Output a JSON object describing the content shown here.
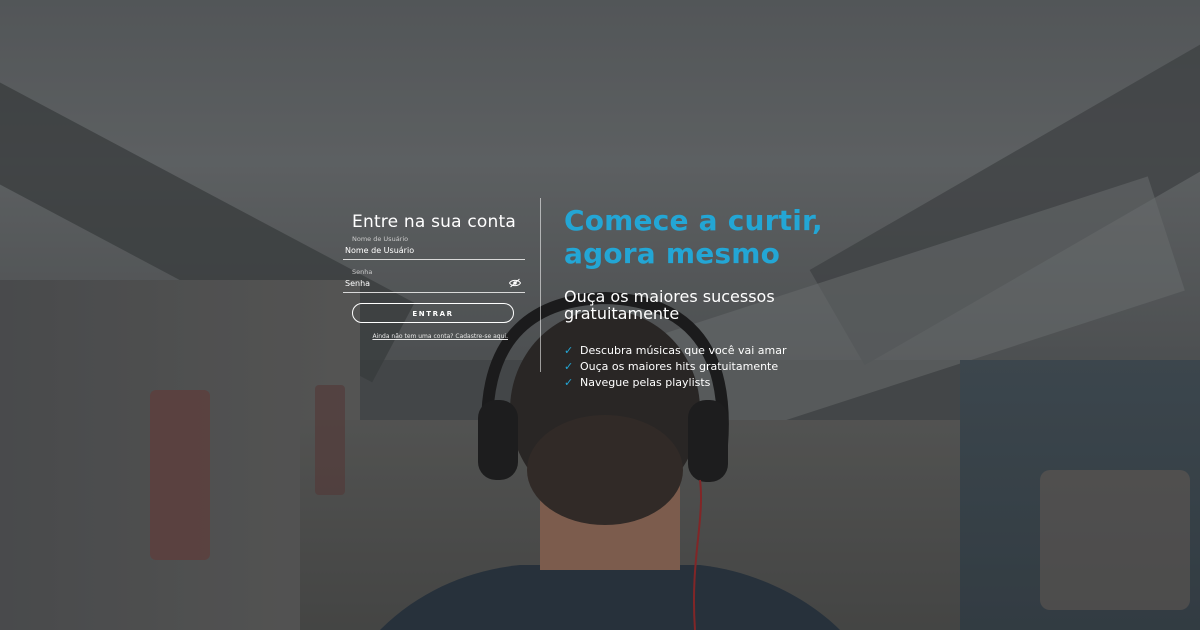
{
  "login": {
    "title": "Entre na sua conta",
    "username": {
      "label": "Nome de Usuário",
      "value": "Nome de Usuário"
    },
    "password": {
      "label": "Senha",
      "value": "Senha"
    },
    "submit_label": "ENTRAR",
    "signup_link": "Ainda não tem uma conta? Cadastre-se aqui."
  },
  "promo": {
    "heading_line1": "Comece a curtir,",
    "heading_line2": "agora mesmo",
    "subtitle_line1": "Ouça os maiores sucessos",
    "subtitle_line2": "gratuitamente",
    "features": [
      "Descubra músicas que você vai amar",
      "Ouça os maiores hits gratuitamente",
      "Navegue pelas playlists"
    ]
  },
  "colors": {
    "accent": "#23a6d5",
    "text": "#ffffff"
  },
  "icons": {
    "show_password": "eye-icon",
    "feature_bullet": "check-icon"
  }
}
